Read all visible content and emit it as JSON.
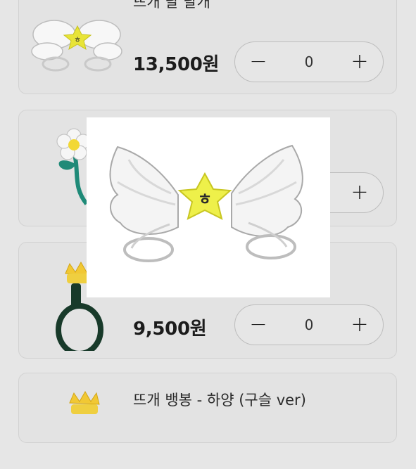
{
  "products": [
    {
      "name": "뜨개 날 날개",
      "price": "13,500원",
      "qty": "0",
      "image_icon": "angel-wing-star-icon"
    },
    {
      "name": "",
      "price": "",
      "qty": "",
      "image_icon": "flower-stem-icon"
    },
    {
      "name": "",
      "price": "9,500원",
      "qty": "0",
      "image_icon": "crown-ring-icon"
    },
    {
      "name": "뜨개 뱅봉 - 하양 (구슬 ver)",
      "price": "",
      "qty": "",
      "image_icon": "crown-icon"
    }
  ],
  "stepper": {
    "minus": "−",
    "plus": "+"
  },
  "preview": {
    "image_icon": "angel-wing-star-icon"
  }
}
